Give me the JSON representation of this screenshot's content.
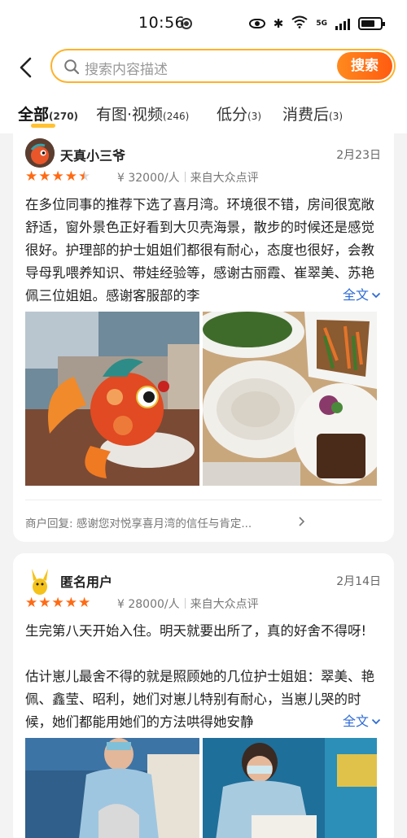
{
  "status_bar": {
    "time": "10:56",
    "network": "5G"
  },
  "search": {
    "placeholder": "搜索内容描述",
    "button_label": "搜索"
  },
  "tabs": [
    {
      "label": "全部",
      "count": "(270)",
      "active": true
    },
    {
      "label": "有图·视频",
      "count": "(246)",
      "active": false
    },
    {
      "label": "低分",
      "count": "(3)",
      "active": false
    },
    {
      "label": "消费后",
      "count": "(3)",
      "active": false
    }
  ],
  "reviews": [
    {
      "user": "天真小三爷",
      "date": "2月23日",
      "rating": 4.5,
      "price": "¥ 32000/人",
      "source": "来自大众点评",
      "text": "在多位同事的推荐下选了喜月湾。环境很不错，房间很宽敞舒适，窗外景色正好看到大贝壳海景，散步的时候还是感觉很好。护理部的护士姐姐们都很有耐心，态度也很好，会教导母乳喂养知识、带娃经验等，感谢古丽霞、崔翠美、苏艳佩三位姐姐。感谢客服部的李",
      "expand_label": "全文",
      "merchant_reply": "商户回复: 感谢您对悦享喜月湾的信任与肯定..."
    },
    {
      "user": "匿名用户",
      "date": "2月14日",
      "rating": 5,
      "price": "¥ 28000/人",
      "source": "来自大众点评",
      "text_p1": "生完第八天开始入住。明天就要出所了，真的好舍不得呀!",
      "text_p2": "估计崽儿最舍不得的就是照顾她的几位护士姐姐：翠美、艳佩、鑫莹、昭利，她们对崽儿特别有耐心，当崽儿哭的时候，她们都能用她们的方法哄得她安静",
      "expand_label": "全文"
    }
  ],
  "colors": {
    "accent": "#ff6a13",
    "search_border": "#ffb128",
    "link": "#2e6bd6",
    "tab_underline": "#ffc233"
  },
  "icons": [
    "back-arrow-icon",
    "search-icon",
    "chevron-down-icon",
    "chevron-right-icon",
    "star-icon"
  ]
}
